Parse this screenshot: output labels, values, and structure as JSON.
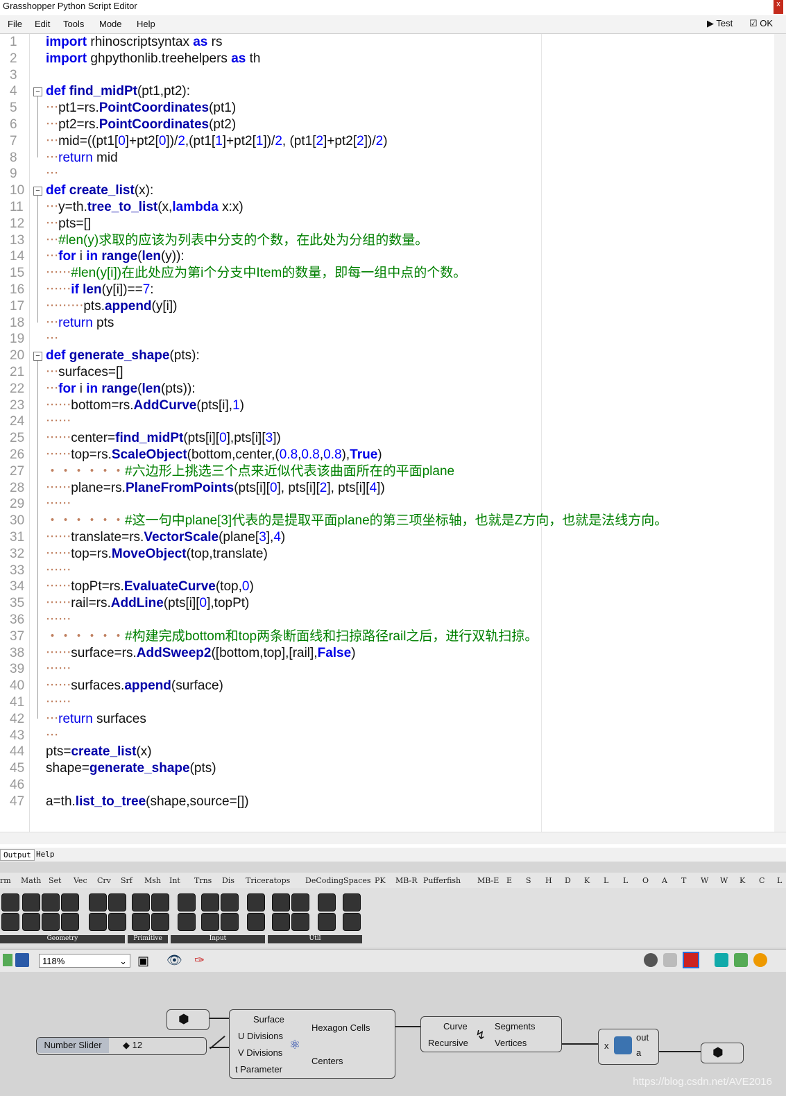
{
  "window": {
    "title": "Grasshopper Python Script Editor",
    "close_glyph": "x"
  },
  "menu": {
    "items": [
      "File",
      "Edit",
      "Tools",
      "Mode",
      "Help"
    ],
    "test_label": "Test",
    "ok_label": "OK"
  },
  "editor": {
    "line_numbers": [
      "1",
      "2",
      "3",
      "4",
      "5",
      "6",
      "7",
      "8",
      "9",
      "10",
      "11",
      "12",
      "13",
      "14",
      "15",
      "16",
      "17",
      "18",
      "19",
      "20",
      "21",
      "22",
      "23",
      "24",
      "25",
      "26",
      "27",
      "28",
      "29",
      "30",
      "31",
      "32",
      "33",
      "34",
      "35",
      "36",
      "37",
      "38",
      "39",
      "40",
      "41",
      "42",
      "43",
      "44",
      "45",
      "46",
      "47"
    ]
  },
  "output_tabs": [
    "Output",
    "Help"
  ],
  "gh": {
    "category_tabs": [
      "rm",
      "Math",
      "Set",
      "Vec",
      "Crv",
      "Srf",
      "Msh",
      "Int",
      "Trns",
      "Dis",
      "Triceratops",
      "DeCodingSpaces",
      "PK",
      "MB-R",
      "Pufferfish",
      "MB-E",
      "E",
      "S",
      "H",
      "D",
      "K",
      "L",
      "L",
      "O",
      "A",
      "T",
      "W",
      "W",
      "K",
      "C",
      "L"
    ],
    "groups": [
      "Geometry",
      "Primitive",
      "Input",
      "Util"
    ],
    "zoom": "118%",
    "components": {
      "slider_label": "Number Slider",
      "slider_value": "◆ 12",
      "hex_inputs": [
        "Surface",
        "U Divisions",
        "V Divisions",
        "t Parameter"
      ],
      "hex_outputs": [
        "Hexagon Cells",
        "Centers"
      ],
      "seg_inputs": [
        "Curve",
        "Recursive"
      ],
      "seg_outputs": [
        "Segments",
        "Vertices"
      ],
      "py_input": "x",
      "py_outputs": [
        "out",
        "a"
      ]
    }
  },
  "watermark": "https://blog.csdn.net/AVE2016"
}
